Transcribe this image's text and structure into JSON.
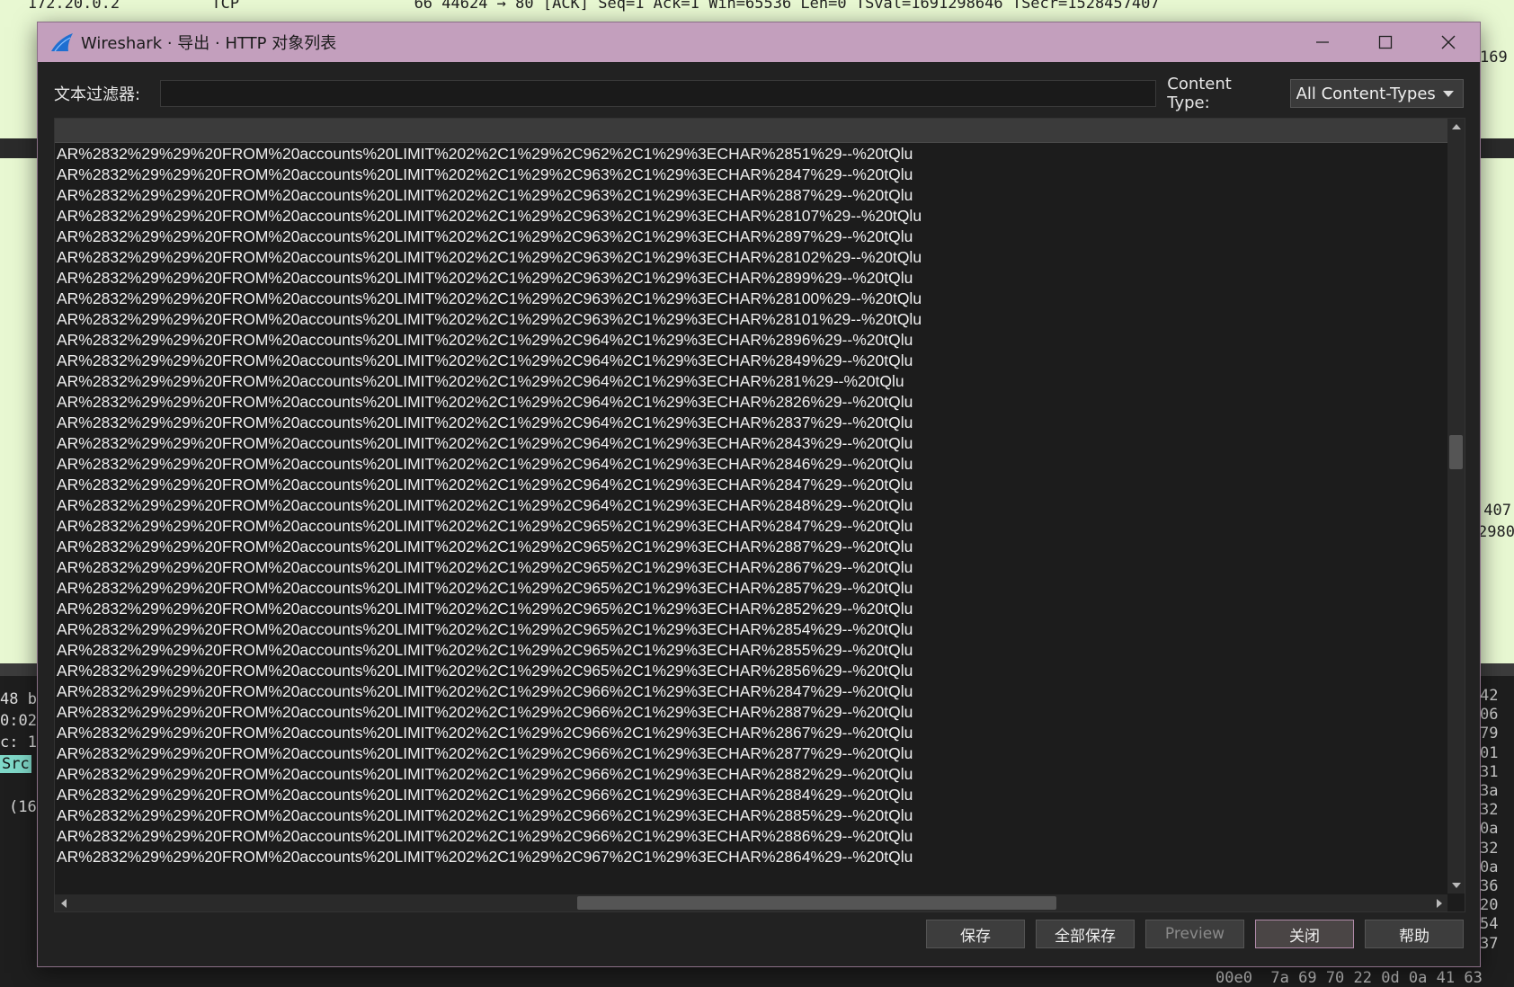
{
  "background": {
    "top_line_1": "   172.20.0.2          TCP                   66 44624 → 80 [ACK] Seq=1 Ack=1 Win=65536 Len=0 TSval=1691298646 TSecr=1528457407",
    "right_fragment_1": "169",
    "right_fragment_2": "'407",
    "right_fragment_3": "2980",
    "detail_lines": [
      "48 b",
      "0:02",
      "c: 1"
    ],
    "src_label": "Src",
    "detail_extra": "(16",
    "hex_right": [
      "42",
      "06",
      "79",
      "01",
      "31",
      "3a",
      "32",
      "0a",
      "32",
      "0a",
      "36",
      "20",
      "54",
      "37"
    ],
    "hex_bottom": "00e0  7a 69 70 22 0d 0a 41 63"
  },
  "dialog": {
    "title": "Wireshark · 导出 · HTTP 对象列表",
    "filter_label": "文本过滤器:",
    "filter_value": "",
    "content_type_label": "Content Type:",
    "content_type_value": "All Content-Types",
    "rows": [
      "AR%2832%29%29%20FROM%20accounts%20LIMIT%202%2C1%29%2C962%2C1%29%3ECHAR%2851%29--%20tQlu",
      "AR%2832%29%29%20FROM%20accounts%20LIMIT%202%2C1%29%2C963%2C1%29%3ECHAR%2847%29--%20tQlu",
      "AR%2832%29%29%20FROM%20accounts%20LIMIT%202%2C1%29%2C963%2C1%29%3ECHAR%2887%29--%20tQlu",
      "AR%2832%29%29%20FROM%20accounts%20LIMIT%202%2C1%29%2C963%2C1%29%3ECHAR%28107%29--%20tQlu",
      "AR%2832%29%29%20FROM%20accounts%20LIMIT%202%2C1%29%2C963%2C1%29%3ECHAR%2897%29--%20tQlu",
      "AR%2832%29%29%20FROM%20accounts%20LIMIT%202%2C1%29%2C963%2C1%29%3ECHAR%28102%29--%20tQlu",
      "AR%2832%29%29%20FROM%20accounts%20LIMIT%202%2C1%29%2C963%2C1%29%3ECHAR%2899%29--%20tQlu",
      "AR%2832%29%29%20FROM%20accounts%20LIMIT%202%2C1%29%2C963%2C1%29%3ECHAR%28100%29--%20tQlu",
      "AR%2832%29%29%20FROM%20accounts%20LIMIT%202%2C1%29%2C963%2C1%29%3ECHAR%28101%29--%20tQlu",
      "AR%2832%29%29%20FROM%20accounts%20LIMIT%202%2C1%29%2C964%2C1%29%3ECHAR%2896%29--%20tQlu",
      "AR%2832%29%29%20FROM%20accounts%20LIMIT%202%2C1%29%2C964%2C1%29%3ECHAR%2849%29--%20tQlu",
      "AR%2832%29%29%20FROM%20accounts%20LIMIT%202%2C1%29%2C964%2C1%29%3ECHAR%281%29--%20tQlu",
      "AR%2832%29%29%20FROM%20accounts%20LIMIT%202%2C1%29%2C964%2C1%29%3ECHAR%2826%29--%20tQlu",
      "AR%2832%29%29%20FROM%20accounts%20LIMIT%202%2C1%29%2C964%2C1%29%3ECHAR%2837%29--%20tQlu",
      "AR%2832%29%29%20FROM%20accounts%20LIMIT%202%2C1%29%2C964%2C1%29%3ECHAR%2843%29--%20tQlu",
      "AR%2832%29%29%20FROM%20accounts%20LIMIT%202%2C1%29%2C964%2C1%29%3ECHAR%2846%29--%20tQlu",
      "AR%2832%29%29%20FROM%20accounts%20LIMIT%202%2C1%29%2C964%2C1%29%3ECHAR%2847%29--%20tQlu",
      "AR%2832%29%29%20FROM%20accounts%20LIMIT%202%2C1%29%2C964%2C1%29%3ECHAR%2848%29--%20tQlu",
      "AR%2832%29%29%20FROM%20accounts%20LIMIT%202%2C1%29%2C965%2C1%29%3ECHAR%2847%29--%20tQlu",
      "AR%2832%29%29%20FROM%20accounts%20LIMIT%202%2C1%29%2C965%2C1%29%3ECHAR%2887%29--%20tQlu",
      "AR%2832%29%29%20FROM%20accounts%20LIMIT%202%2C1%29%2C965%2C1%29%3ECHAR%2867%29--%20tQlu",
      "AR%2832%29%29%20FROM%20accounts%20LIMIT%202%2C1%29%2C965%2C1%29%3ECHAR%2857%29--%20tQlu",
      "AR%2832%29%29%20FROM%20accounts%20LIMIT%202%2C1%29%2C965%2C1%29%3ECHAR%2852%29--%20tQlu",
      "AR%2832%29%29%20FROM%20accounts%20LIMIT%202%2C1%29%2C965%2C1%29%3ECHAR%2854%29--%20tQlu",
      "AR%2832%29%29%20FROM%20accounts%20LIMIT%202%2C1%29%2C965%2C1%29%3ECHAR%2855%29--%20tQlu",
      "AR%2832%29%29%20FROM%20accounts%20LIMIT%202%2C1%29%2C965%2C1%29%3ECHAR%2856%29--%20tQlu",
      "AR%2832%29%29%20FROM%20accounts%20LIMIT%202%2C1%29%2C966%2C1%29%3ECHAR%2847%29--%20tQlu",
      "AR%2832%29%29%20FROM%20accounts%20LIMIT%202%2C1%29%2C966%2C1%29%3ECHAR%2887%29--%20tQlu",
      "AR%2832%29%29%20FROM%20accounts%20LIMIT%202%2C1%29%2C966%2C1%29%3ECHAR%2867%29--%20tQlu",
      "AR%2832%29%29%20FROM%20accounts%20LIMIT%202%2C1%29%2C966%2C1%29%3ECHAR%2877%29--%20tQlu",
      "AR%2832%29%29%20FROM%20accounts%20LIMIT%202%2C1%29%2C966%2C1%29%3ECHAR%2882%29--%20tQlu",
      "AR%2832%29%29%20FROM%20accounts%20LIMIT%202%2C1%29%2C966%2C1%29%3ECHAR%2884%29--%20tQlu",
      "AR%2832%29%29%20FROM%20accounts%20LIMIT%202%2C1%29%2C966%2C1%29%3ECHAR%2885%29--%20tQlu",
      "AR%2832%29%29%20FROM%20accounts%20LIMIT%202%2C1%29%2C966%2C1%29%3ECHAR%2886%29--%20tQlu",
      "AR%2832%29%29%20FROM%20accounts%20LIMIT%202%2C1%29%2C967%2C1%29%3ECHAR%2864%29--%20tQlu"
    ],
    "buttons": {
      "save": "保存",
      "save_all": "全部保存",
      "preview": "Preview",
      "close": "关闭",
      "help": "帮助"
    }
  },
  "colors": {
    "titlebar": "#c39fbd",
    "dialog_bg": "#222222",
    "background_packet_list": "#e8f8d2"
  }
}
